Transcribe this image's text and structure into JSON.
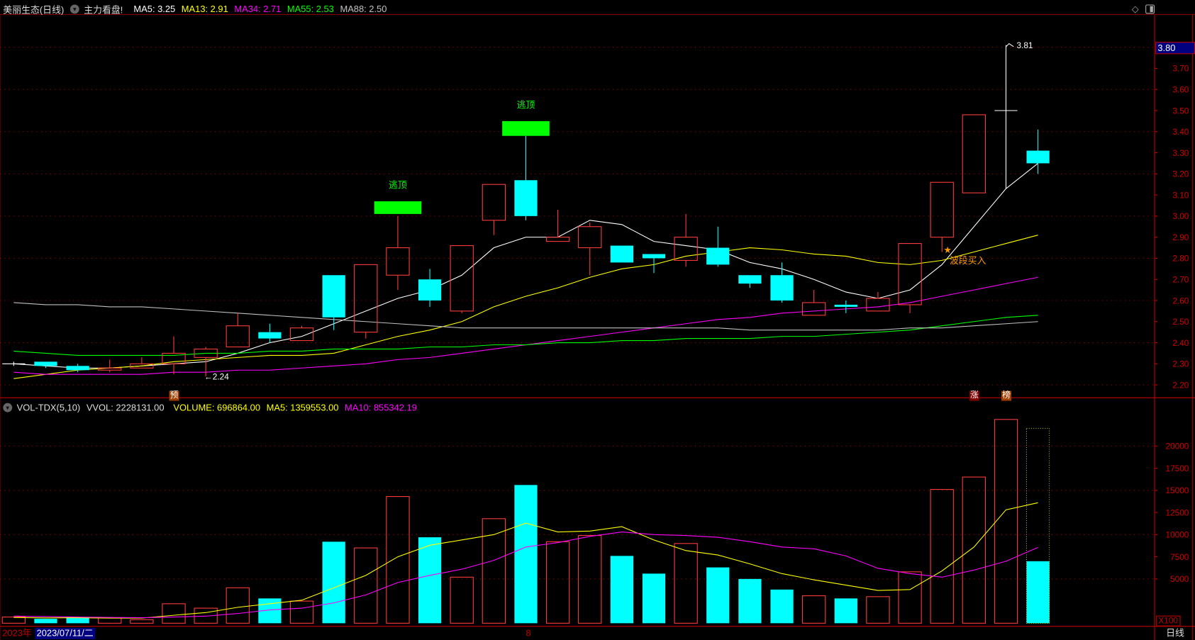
{
  "header": {
    "title": "美丽生态(日线)",
    "indicator": "主力看盘!",
    "ma": [
      {
        "label": "MA5: 3.25",
        "color": "#ffffff"
      },
      {
        "label": "MA13: 2.91",
        "color": "#ffff00"
      },
      {
        "label": "MA34: 2.71",
        "color": "#ff00ff"
      },
      {
        "label": "MA55: 2.53",
        "color": "#00ff00"
      },
      {
        "label": "MA88: 2.50",
        "color": "#c0c0c0"
      }
    ]
  },
  "volume_header": {
    "name": "VOL-TDX(5,10)",
    "vvol": "VVOL: 2228131.00",
    "volume": "VOLUME: 696864.00",
    "ma5": "MA5: 1359553.00",
    "ma10": "MA10: 855342.19"
  },
  "price_cursor_label": "3.80",
  "volume_unit": "X100",
  "period_label": "日线",
  "date_axis": {
    "year": "2023年",
    "selected_date": "2023/07/11/二",
    "month_mark": "8"
  },
  "markers": {
    "pre": "预",
    "zhang": "涨",
    "bang": "榜",
    "wave_buy": "波段买入",
    "escape_top": "逃顶",
    "high_label": "3.81",
    "low_label": "←2.24"
  },
  "colors": {
    "up": "#ff3c3c",
    "down": "#00ffff",
    "axis": "#c00000",
    "signal_green": "#00ff00",
    "buy": "#ff9900"
  },
  "chart_data": [
    {
      "type": "candlestick",
      "title": "美丽生态(日线)",
      "ylim": [
        2.15,
        3.85
      ],
      "yticks": [
        2.2,
        2.3,
        2.4,
        2.5,
        2.6,
        2.7,
        2.8,
        2.9,
        3.0,
        3.1,
        3.2,
        3.3,
        3.4,
        3.5,
        3.6,
        3.7
      ],
      "grid": "dotted horizontal",
      "ohlc": [
        [
          2.3,
          2.31,
          2.29,
          2.3
        ],
        [
          2.31,
          2.31,
          2.28,
          2.29
        ],
        [
          2.29,
          2.3,
          2.26,
          2.27
        ],
        [
          2.27,
          2.32,
          2.26,
          2.28
        ],
        [
          2.28,
          2.33,
          2.28,
          2.3
        ],
        [
          2.3,
          2.43,
          2.25,
          2.35
        ],
        [
          2.33,
          2.38,
          2.24,
          2.37
        ],
        [
          2.38,
          2.54,
          2.38,
          2.48
        ],
        [
          2.45,
          2.49,
          2.4,
          2.42
        ],
        [
          2.41,
          2.48,
          2.41,
          2.47
        ],
        [
          2.72,
          2.72,
          2.46,
          2.52
        ],
        [
          2.45,
          2.77,
          2.42,
          2.77
        ],
        [
          2.72,
          3.0,
          2.65,
          2.85
        ],
        [
          2.7,
          2.75,
          2.57,
          2.6
        ],
        [
          2.55,
          2.86,
          2.54,
          2.86
        ],
        [
          2.98,
          3.15,
          2.91,
          3.15
        ],
        [
          3.17,
          3.38,
          2.98,
          3.0
        ],
        [
          2.88,
          3.03,
          2.88,
          2.9
        ],
        [
          2.85,
          2.97,
          2.72,
          2.95
        ],
        [
          2.86,
          2.86,
          2.78,
          2.78
        ],
        [
          2.82,
          2.82,
          2.73,
          2.8
        ],
        [
          2.79,
          3.01,
          2.76,
          2.9
        ],
        [
          2.85,
          2.95,
          2.76,
          2.77
        ],
        [
          2.72,
          2.72,
          2.66,
          2.68
        ],
        [
          2.72,
          2.78,
          2.59,
          2.6
        ],
        [
          2.53,
          2.65,
          2.53,
          2.59
        ],
        [
          2.58,
          2.6,
          2.54,
          2.57
        ],
        [
          2.55,
          2.64,
          2.55,
          2.61
        ],
        [
          2.58,
          2.87,
          2.54,
          2.87
        ],
        [
          2.9,
          3.16,
          2.83,
          3.16
        ],
        [
          3.11,
          3.48,
          3.11,
          3.48
        ],
        [
          3.5,
          3.81,
          3.13,
          3.5
        ],
        [
          3.31,
          3.41,
          3.2,
          3.25
        ]
      ],
      "series": [
        {
          "name": "MA5",
          "color": "#ffffff",
          "values": [
            2.3,
            2.29,
            2.28,
            2.28,
            2.29,
            2.3,
            2.31,
            2.35,
            2.4,
            2.43,
            2.49,
            2.55,
            2.61,
            2.65,
            2.72,
            2.85,
            2.9,
            2.9,
            2.98,
            2.96,
            2.88,
            2.86,
            2.84,
            2.78,
            2.75,
            2.7,
            2.64,
            2.61,
            2.65,
            2.77,
            2.95,
            3.13,
            3.25
          ]
        },
        {
          "name": "MA13",
          "color": "#ffff00",
          "values": [
            2.23,
            2.25,
            2.27,
            2.28,
            2.29,
            2.31,
            2.32,
            2.33,
            2.34,
            2.34,
            2.35,
            2.39,
            2.43,
            2.46,
            2.5,
            2.57,
            2.62,
            2.66,
            2.71,
            2.75,
            2.77,
            2.81,
            2.83,
            2.85,
            2.84,
            2.82,
            2.81,
            2.78,
            2.77,
            2.79,
            2.83,
            2.87,
            2.91
          ]
        },
        {
          "name": "MA34",
          "color": "#ff00ff",
          "values": [
            2.26,
            2.25,
            2.25,
            2.25,
            2.25,
            2.26,
            2.26,
            2.27,
            2.27,
            2.28,
            2.29,
            2.3,
            2.32,
            2.33,
            2.35,
            2.37,
            2.39,
            2.41,
            2.43,
            2.45,
            2.47,
            2.49,
            2.51,
            2.52,
            2.54,
            2.55,
            2.56,
            2.57,
            2.59,
            2.62,
            2.65,
            2.68,
            2.71
          ]
        },
        {
          "name": "MA55",
          "color": "#00ff00",
          "values": [
            2.36,
            2.35,
            2.34,
            2.34,
            2.34,
            2.34,
            2.35,
            2.35,
            2.36,
            2.36,
            2.37,
            2.37,
            2.37,
            2.38,
            2.38,
            2.39,
            2.39,
            2.4,
            2.4,
            2.41,
            2.41,
            2.42,
            2.42,
            2.42,
            2.43,
            2.43,
            2.44,
            2.45,
            2.46,
            2.48,
            2.5,
            2.52,
            2.53
          ]
        },
        {
          "name": "MA88",
          "color": "#c0c0c0",
          "values": [
            2.59,
            2.58,
            2.58,
            2.57,
            2.57,
            2.56,
            2.55,
            2.54,
            2.53,
            2.52,
            2.51,
            2.5,
            2.49,
            2.48,
            2.47,
            2.47,
            2.47,
            2.47,
            2.47,
            2.47,
            2.47,
            2.47,
            2.47,
            2.46,
            2.46,
            2.46,
            2.46,
            2.46,
            2.47,
            2.47,
            2.48,
            2.49,
            2.5
          ]
        }
      ],
      "signals": [
        {
          "label": "逃顶",
          "index": 12,
          "top": 3.07,
          "bottom": 3.01
        },
        {
          "label": "逃顶",
          "index": 16,
          "top": 3.45,
          "bottom": 3.38
        },
        {
          "label": "波段买入",
          "index": 29,
          "price": 2.84
        }
      ]
    },
    {
      "type": "bar",
      "title": "VOL-TDX(5,10)",
      "unit": "X100",
      "ylim": [
        0,
        24000
      ],
      "yticks": [
        5000,
        7500,
        10000,
        12500,
        15000,
        17500,
        20000
      ],
      "values": [
        700,
        500,
        700,
        600,
        400,
        2200,
        1700,
        4000,
        2800,
        2500,
        9200,
        8500,
        14300,
        9700,
        5200,
        11800,
        15600,
        9200,
        9900,
        7600,
        5600,
        9000,
        6300,
        5000,
        3800,
        3100,
        2800,
        3000,
        5800,
        15100,
        16500,
        23000,
        7000
      ],
      "last_bar_outline": 22000,
      "series": [
        {
          "name": "MA5",
          "color": "#ffff00",
          "values": [
            650,
            600,
            620,
            580,
            580,
            900,
            1200,
            1800,
            2200,
            2600,
            4000,
            5400,
            7500,
            8800,
            9400,
            10000,
            11300,
            10300,
            10400,
            10900,
            9400,
            8200,
            7700,
            6700,
            5600,
            4900,
            4300,
            3700,
            3800,
            5900,
            8600,
            12800,
            13600
          ]
        },
        {
          "name": "MA10",
          "color": "#ff00ff",
          "values": [
            800,
            750,
            700,
            650,
            620,
            700,
            800,
            1100,
            1500,
            1700,
            2300,
            3200,
            4600,
            5400,
            6100,
            7100,
            8600,
            9100,
            9800,
            10300,
            10000,
            9900,
            9700,
            9200,
            8600,
            8400,
            7600,
            6200,
            5600,
            5200,
            6000,
            7000,
            8553
          ]
        }
      ]
    }
  ]
}
